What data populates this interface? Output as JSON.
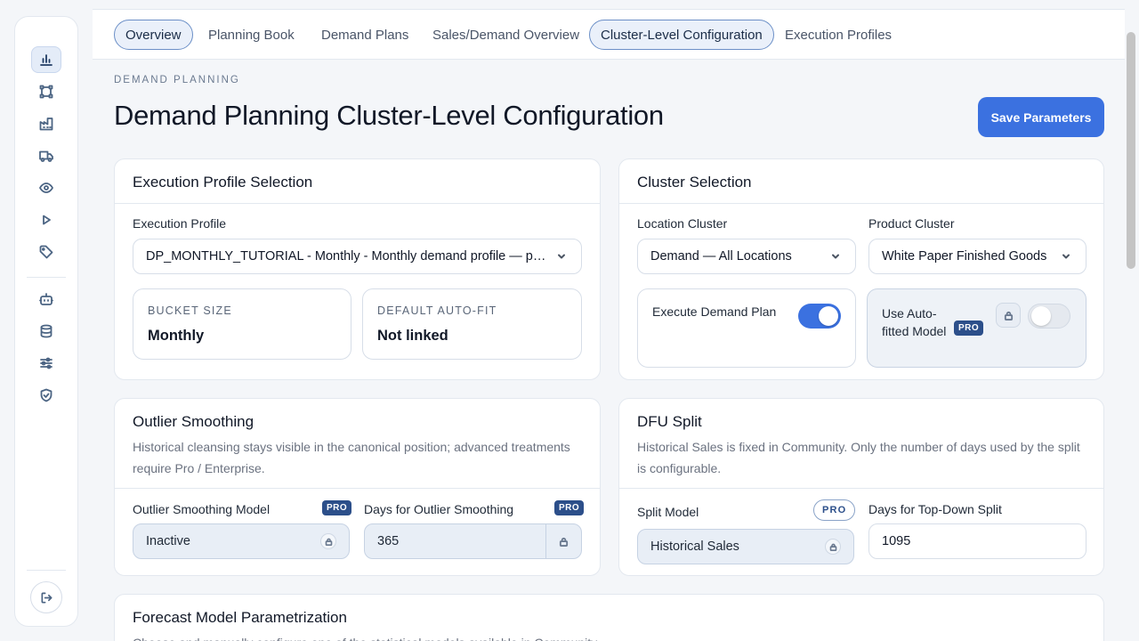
{
  "tabs": [
    {
      "label": "Overview"
    },
    {
      "label": "Planning Book"
    },
    {
      "label": "Demand Plans"
    },
    {
      "label": "Sales/Demand Overview"
    },
    {
      "label": "Cluster-Level Configuration"
    },
    {
      "label": "Execution Profiles"
    }
  ],
  "header": {
    "eyebrow": "DEMAND PLANNING",
    "title": "Demand Planning Cluster-Level Configuration",
    "save_label": "Save Parameters"
  },
  "execution_profile": {
    "title": "Execution Profile Selection",
    "field_label": "Execution Profile",
    "selected": "DP_MONTHLY_TUTORIAL - Monthly - Monthly demand profile — passes the validation tutorial",
    "bucket_label": "BUCKET SIZE",
    "bucket_value": "Monthly",
    "autofit_label": "DEFAULT AUTO-FIT",
    "autofit_value": "Not linked"
  },
  "cluster": {
    "title": "Cluster Selection",
    "location_label": "Location Cluster",
    "location_value": "Demand — All Locations",
    "product_label": "Product Cluster",
    "product_value": "White Paper Finished Goods",
    "execute_label": "Execute Demand Plan",
    "execute_on": true,
    "autofit_label": "Use Auto-fitted Model",
    "autofit_badge": "PRO",
    "autofit_on": false
  },
  "outlier": {
    "title": "Outlier Smoothing",
    "desc": "Historical cleansing stays visible in the canonical position; advanced treatments require Pro / Enterprise.",
    "model_label": "Outlier Smoothing Model",
    "model_badge": "PRO",
    "model_value": "Inactive",
    "days_label": "Days for Outlier Smoothing",
    "days_badge": "PRO",
    "days_value": "365"
  },
  "dfu": {
    "title": "DFU Split",
    "desc": "Historical Sales is fixed in Community. Only the number of days used by the split is configurable.",
    "model_label": "Split Model",
    "model_badge": "PRO",
    "model_value": "Historical Sales",
    "days_label": "Days for Top-Down Split",
    "days_value": "1095"
  },
  "forecast": {
    "title": "Forecast Model Parametrization",
    "desc": "Choose and manually configure one of the statistical models available in Community."
  },
  "colors": {
    "accent": "#3b71e0",
    "pro_badge": "#2c4f8a"
  }
}
